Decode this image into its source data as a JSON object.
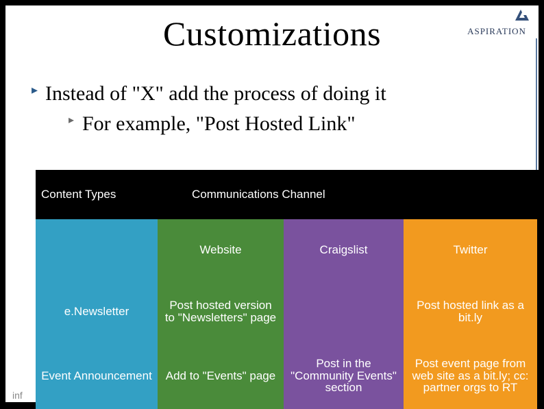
{
  "logo_text": "ASPIRATION",
  "title": "Customizations",
  "bullets": {
    "level1": "Instead of \"X\" add the process of doing it",
    "level2": "For example, \"Post Hosted Link\""
  },
  "footer_fragment": "inf",
  "table": {
    "header_left": "Content Types",
    "header_right": "Communications Channel",
    "channels": {
      "c1": "Website",
      "c2": "Craigslist",
      "c3": "Twitter"
    },
    "rows": [
      {
        "label": "e.Newsletter",
        "c1": "Post hosted version to \"Newsletters\" page",
        "c2": "",
        "c3": "Post hosted link as a bit.ly"
      },
      {
        "label": "Event Announcement",
        "c1": "Add to \"Events\" page",
        "c2": "Post in the \"Community Events\" section",
        "c3": "Post event page from web site as a bit.ly; cc: partner orgs to RT"
      }
    ]
  }
}
